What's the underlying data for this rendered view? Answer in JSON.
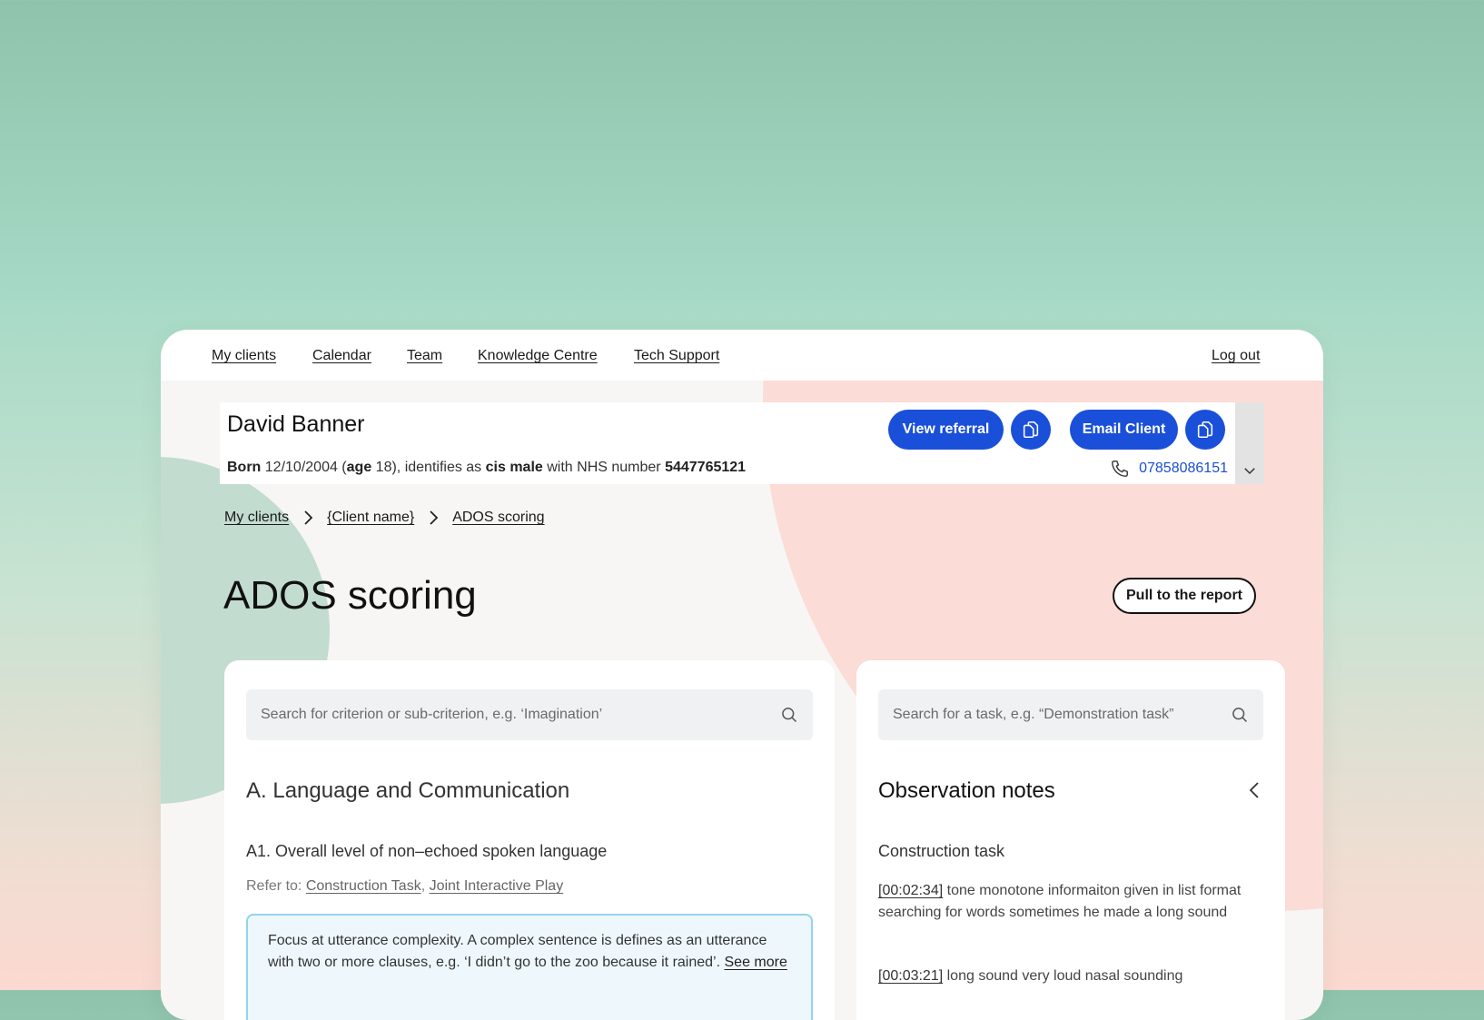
{
  "nav": {
    "items": [
      "My clients",
      "Calendar",
      "Team",
      "Knowledge Centre",
      "Tech Support"
    ],
    "logout": "Log out"
  },
  "client": {
    "name": "David Banner",
    "born_label": "Born",
    "dob": "12/10/2004",
    "age_label": "age",
    "age": "18",
    "identifies_text": "), identifies as",
    "gender": "cis male",
    "nhs_text": "with NHS number",
    "nhs_number": "5447765121",
    "phone": "07858086151",
    "view_referral": "View referral",
    "email_client": "Email Client"
  },
  "breadcrumb": [
    "My clients",
    "{Client name}",
    "ADOS scoring"
  ],
  "page": {
    "title": "ADOS scoring",
    "pull_button": "Pull to the report"
  },
  "left_panel": {
    "search_placeholder": "Search for criterion or sub-criterion, e.g. ‘Imagination’",
    "section_title": "A. Language and Communication",
    "criterion": "A1. Overall level of non–echoed spoken language",
    "refer_label": "Refer to:",
    "refer_links": [
      "Construction Task",
      "Joint Interactive Play"
    ],
    "info_text": "Focus at utterance complexity. A complex sentence is defines as an utterance with two or more clauses, e.g. ‘I didn’t go to the zoo because it rained’.",
    "see_more": "See more"
  },
  "right_panel": {
    "search_placeholder": "Search for a task, e.g. “Demonstration task”",
    "title": "Observation notes",
    "task": "Construction task",
    "notes": [
      {
        "time": "[00:02:34]",
        "text": " tone monotone informaiton given in list format searching for words sometimes he made a long sound"
      },
      {
        "time": "[00:03:21]",
        "text": " long sound very loud nasal sounding"
      }
    ]
  },
  "colors": {
    "primary": "#1a4fd9",
    "info_border": "#93d3ef",
    "info_bg": "#eef7fb",
    "blob_pink": "#fbdcd6",
    "blob_green": "#c3dcd0"
  },
  "icons": [
    "copy-icon",
    "phone-icon",
    "chevron-down-icon",
    "chevron-right-icon",
    "search-icon",
    "chevron-left-icon"
  ]
}
